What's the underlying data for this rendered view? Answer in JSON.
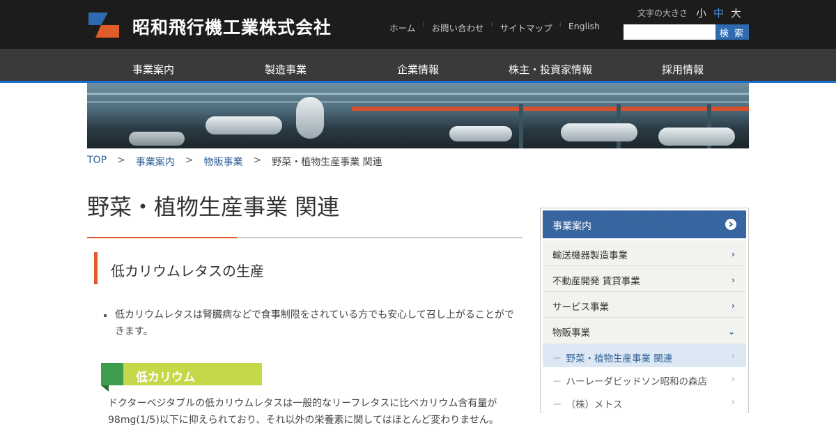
{
  "header": {
    "company_name": "昭和飛行機工業株式会社",
    "util_links": [
      "ホーム",
      "お問い合わせ",
      "サイトマップ",
      "English"
    ],
    "font_size": {
      "label": "文字の大きさ",
      "options": [
        "小",
        "中",
        "大"
      ],
      "active": "中"
    },
    "search": {
      "placeholder": "",
      "button_label": "検 索"
    }
  },
  "global_nav": [
    "事業案内",
    "製造事業",
    "企業情報",
    "株主・投資家情報",
    "採用情報"
  ],
  "breadcrumb": {
    "items": [
      "TOP",
      "事業案内",
      "物販事業"
    ],
    "current": "野菜・植物生産事業 関連",
    "separator": ">"
  },
  "main": {
    "page_title": "野菜・植物生産事業 関連",
    "section_heading": "低カリウムレタスの生産",
    "bullet": "低カリウムレタスは腎臓病などで食事制限をされている方でも安心して召し上がることができます。",
    "badge": "低カリウム",
    "paragraph": "ドクターベジタブルの低カリウムレタスは一般的なリーフレタスに比べカリウム含有量が98mg(1/5)以下に抑えられており、それ以外の栄養素に関してはほとんど変わりません。"
  },
  "sidebar": {
    "heading": "事業案内",
    "items": [
      "輸送機器製造事業",
      "不動産開発 賃貸事業",
      "サービス事業",
      "物販事業"
    ],
    "sub_items": [
      "野菜・植物生産事業 関連",
      "ハーレーダビッドソン昭和の森店",
      "（株）メトス"
    ],
    "sub_prefix": "－"
  },
  "colors": {
    "accent_orange": "#e05c2b",
    "brand_blue": "#2f6ab0",
    "nav_dark": "#3a3a38",
    "header_dark": "#1c1c1a",
    "badge_green": "#3f9e4e",
    "badge_lime": "#c4d84a"
  }
}
